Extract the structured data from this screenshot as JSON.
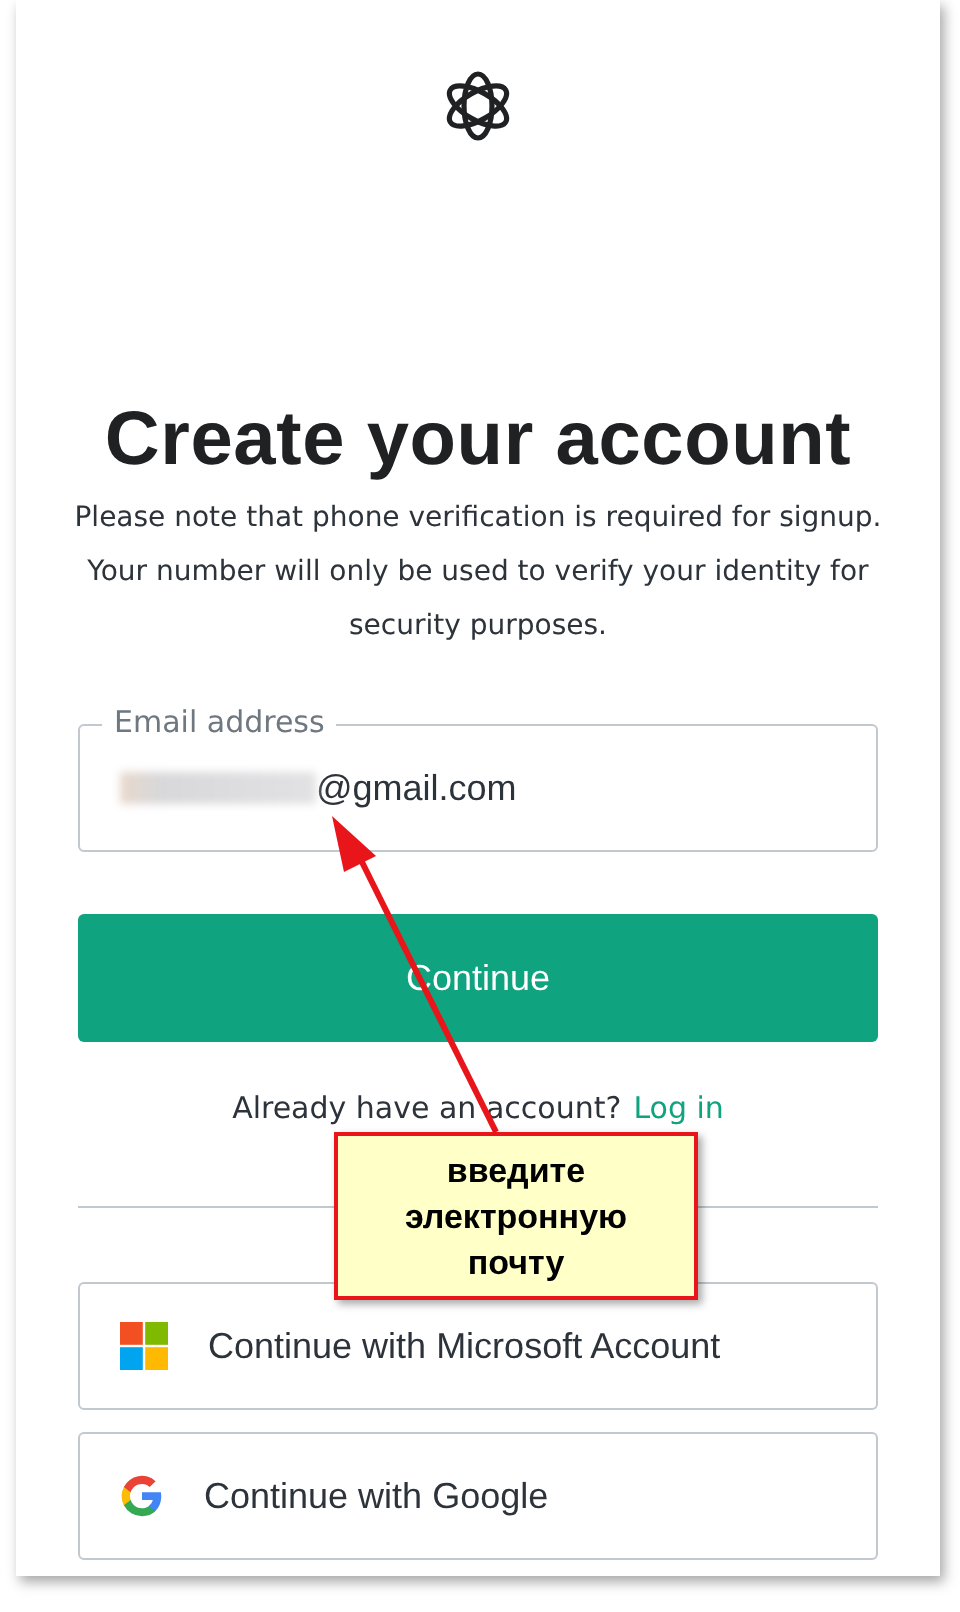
{
  "title": "Create your account",
  "notice": "Please note that phone verification is required for signup. Your number will only be used to verify your identity for security purposes.",
  "email_field": {
    "label": "Email address",
    "value": "@gmail.com",
    "redacted_prefix": true
  },
  "continue_button": "Continue",
  "login_prompt": {
    "text": "Already have an account?",
    "link": "Log in"
  },
  "providers": [
    {
      "kind": "microsoft",
      "label": "Continue with Microsoft Account"
    },
    {
      "kind": "google",
      "label": "Continue with Google"
    }
  ],
  "annotation": {
    "text": "введите электронную почту"
  }
}
